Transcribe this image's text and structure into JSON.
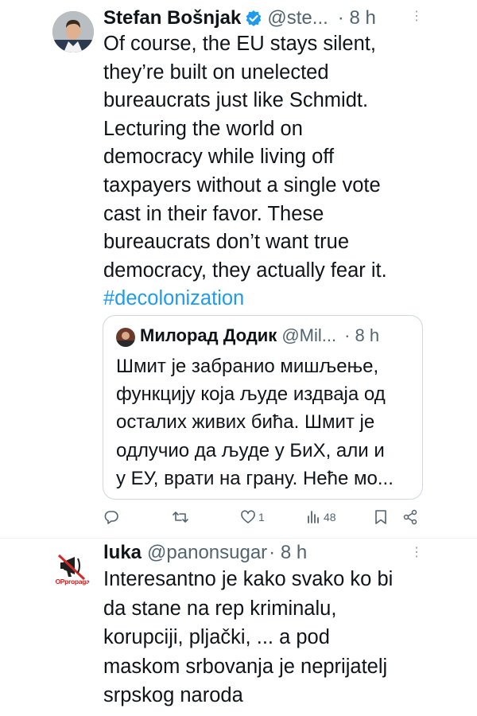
{
  "tweet": {
    "author": "Stefan Bošnjak",
    "handle": "@ste...",
    "time": "· 8 h",
    "lines": [
      "Of course, the EU stays silent,",
      "they’re built on unelected",
      "bureaucrats just like Schmidt.",
      "Lecturing the world on",
      "democracy while living off",
      "taxpayers without a single vote",
      "cast in their favor. These",
      "bureaucrats don’t want true",
      "democracy, they actually fear it."
    ],
    "hashtag": "#decolonization",
    "quote": {
      "author": "Милорад Додик",
      "handle": "@Mil...",
      "time": "· 8 h",
      "lines": [
        "Шмит је забранио мишљење,",
        "функцију која људе издваја од",
        "осталих живих бића. Шмит је",
        "одлучио да људе у БиХ, али и",
        "у ЕУ, врати на грану. Неће мо..."
      ]
    },
    "actions": {
      "likes": "1",
      "views": "48"
    }
  },
  "reply": {
    "author": "luka",
    "handle": "@panonsugar",
    "time": "· 8 h",
    "avatar_text": "OPpropaga",
    "lines": [
      "Interesantno je kako svako ko bi",
      "da stane na rep kriminalu,",
      "korupciji, pljački, ... a pod",
      "maskom srbovanja je neprijatelj",
      "srpskog naroda"
    ]
  },
  "colors": {
    "link": "#1d9bf0",
    "verified": "#1d9bf0",
    "secondary": "#536471",
    "border": "#cfd9de"
  },
  "icons": [
    "verified-badge-icon",
    "more-icon",
    "reply-icon",
    "retweet-icon",
    "like-icon",
    "views-icon",
    "bookmark-icon",
    "share-icon"
  ]
}
